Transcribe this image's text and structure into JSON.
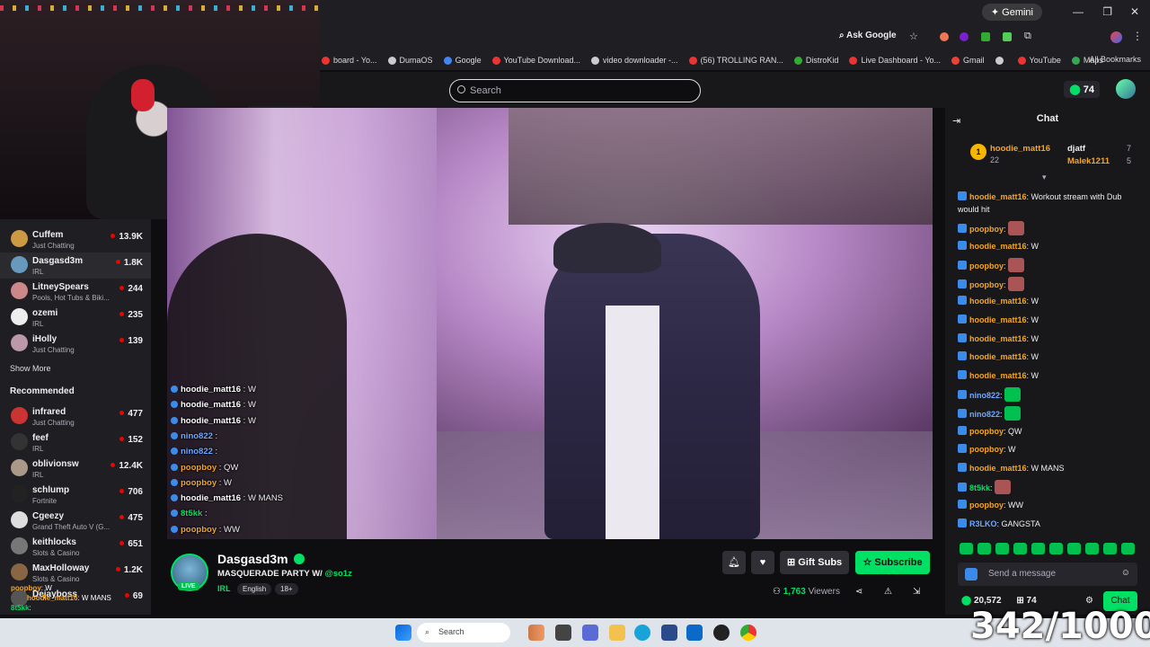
{
  "browser": {
    "gemini_label": "Gemini",
    "ask_google": "Ask Google",
    "bookmarks": [
      {
        "label": "board - Yo...",
        "color": "#e33"
      },
      {
        "label": "DumaOS",
        "color": "#ccc"
      },
      {
        "label": "Google",
        "color": "#4285f4"
      },
      {
        "label": "YouTube Download...",
        "color": "#e33"
      },
      {
        "label": "video downloader -...",
        "color": "#ccc"
      },
      {
        "label": "(56) TROLLING RAN...",
        "color": "#e33"
      },
      {
        "label": "DistroKid",
        "color": "#3a3"
      },
      {
        "label": "Live Dashboard - Yo...",
        "color": "#e33"
      },
      {
        "label": "Gmail",
        "color": "#ea4335"
      },
      {
        "label": "",
        "color": "#ccc"
      },
      {
        "label": "YouTube",
        "color": "#e33"
      },
      {
        "label": "Maps",
        "color": "#34a853"
      }
    ],
    "all_bookmarks": "All Bookmarks"
  },
  "topbar": {
    "search_placeholder": "Search",
    "points": "74"
  },
  "sidebar": {
    "followed": [
      {
        "name": "Cuffem",
        "category": "Just Chatting",
        "viewers": "13.9K",
        "color": "#c94"
      },
      {
        "name": "Dasgasd3m",
        "category": "IRL",
        "viewers": "1.8K",
        "color": "#69b"
      },
      {
        "name": "LitneySpears",
        "category": "Pools, Hot Tubs & Biki...",
        "viewers": "244",
        "color": "#c88"
      },
      {
        "name": "ozemi",
        "category": "IRL",
        "viewers": "235",
        "color": "#eee"
      },
      {
        "name": "iHolly",
        "category": "Just Chatting",
        "viewers": "139",
        "color": "#b9a"
      }
    ],
    "show_more": "Show More",
    "recommended_title": "Recommended",
    "recommended": [
      {
        "name": "infrared",
        "category": "Just Chatting",
        "viewers": "477",
        "color": "#c33"
      },
      {
        "name": "feef",
        "category": "IRL",
        "viewers": "152",
        "color": "#333"
      },
      {
        "name": "oblivionsw",
        "category": "IRL",
        "viewers": "12.4K",
        "color": "#a98"
      },
      {
        "name": "schlump",
        "category": "Fortnite",
        "viewers": "706",
        "color": "#222"
      },
      {
        "name": "Cgeezy",
        "category": "Grand Theft Auto V (G...",
        "viewers": "475",
        "color": "#ddd"
      },
      {
        "name": "keithlocks",
        "category": "Slots & Casino",
        "viewers": "651",
        "color": "#777"
      },
      {
        "name": "MaxHolloway",
        "category": "Slots & Casino",
        "viewers": "1.2K",
        "color": "#864"
      },
      {
        "name": "Dejayboss",
        "category": "",
        "viewers": "69",
        "color": "#555"
      }
    ],
    "overlay_chat": [
      {
        "user": "poopboy",
        "text": ": W",
        "color": "#f5a623"
      },
      {
        "user": "hoodie_matt16",
        "text": ": W MANS",
        "color": "#f5a623"
      },
      {
        "user": "8t5kk",
        "text": ":",
        "color": "#00e064"
      }
    ]
  },
  "video_chat": [
    {
      "user": "hoodie_matt16",
      "text": " : W",
      "color": "#fff"
    },
    {
      "user": "hoodie_matt16",
      "text": " : W",
      "color": "#fff"
    },
    {
      "user": "hoodie_matt16",
      "text": " : W",
      "color": "#fff"
    },
    {
      "user": "nino822",
      "text": " :",
      "color": "#6fa8ff"
    },
    {
      "user": "nino822",
      "text": " :",
      "color": "#6fa8ff"
    },
    {
      "user": "poopboy",
      "text": " : QW",
      "color": "#f5a623"
    },
    {
      "user": "poopboy",
      "text": " : W",
      "color": "#f5a623"
    },
    {
      "user": "hoodie_matt16",
      "text": " : W MANS",
      "color": "#fff"
    },
    {
      "user": "8t5kk",
      "text": " :",
      "color": "#00e064"
    },
    {
      "user": "poopboy",
      "text": " : WW",
      "color": "#f5a623"
    }
  ],
  "stream": {
    "name": "Dasgasd3m",
    "title": "MASQUERADE PARTY W/ ",
    "mention": "@so1z",
    "category": "IRL",
    "tags": [
      "English",
      "18+"
    ],
    "live_label": "LIVE",
    "gift_label": "Gift Subs",
    "subscribe_label": "Subscribe",
    "viewers_count": "1,763",
    "viewers_label": "Viewers"
  },
  "chat": {
    "header": "Chat",
    "leaders": [
      {
        "rank": "1",
        "name": "hoodie_matt16",
        "value": "22"
      },
      {
        "name": "djatf",
        "value": "7"
      },
      {
        "name": "Malek1211",
        "value": "5"
      }
    ],
    "messages": [
      {
        "user": "hoodie_matt16",
        "text": ": Workout stream with Dub would hit",
        "color": "#f5a623"
      },
      {
        "user": "poopboy",
        "text": ":",
        "color": "#f5a623"
      },
      {
        "user": "hoodie_matt16",
        "text": ": W",
        "color": "#f5a623"
      },
      {
        "user": "poopboy",
        "text": ":",
        "color": "#f5a623"
      },
      {
        "user": "poopboy",
        "text": ":",
        "color": "#f5a623"
      },
      {
        "user": "hoodie_matt16",
        "text": ": W",
        "color": "#f5a623"
      },
      {
        "user": "hoodie_matt16",
        "text": ": W",
        "color": "#f5a623"
      },
      {
        "user": "hoodie_matt16",
        "text": ": W",
        "color": "#f5a623"
      },
      {
        "user": "hoodie_matt16",
        "text": ": W",
        "color": "#f5a623"
      },
      {
        "user": "hoodie_matt16",
        "text": ": W",
        "color": "#f5a623"
      },
      {
        "user": "nino822",
        "text": ":",
        "color": "#6fa8ff"
      },
      {
        "user": "nino822",
        "text": ":",
        "color": "#6fa8ff"
      },
      {
        "user": "poopboy",
        "text": ": QW",
        "color": "#f5a623"
      },
      {
        "user": "poopboy",
        "text": ": W",
        "color": "#f5a623"
      },
      {
        "user": "hoodie_matt16",
        "text": ": W MANS",
        "color": "#f5a623"
      },
      {
        "user": "8t5kk",
        "text": ":",
        "color": "#00e064"
      },
      {
        "user": "poopboy",
        "text": ": WW",
        "color": "#f5a623"
      },
      {
        "user": "R3LKO",
        "text": ": GANGSTA",
        "color": "#6fa8ff"
      }
    ],
    "send_placeholder": "Send a message",
    "points": "20,572",
    "gifts": "74",
    "chat_button": "Chat"
  },
  "taskbar": {
    "search_placeholder": "Search"
  },
  "counter_overlay": "342/1000"
}
